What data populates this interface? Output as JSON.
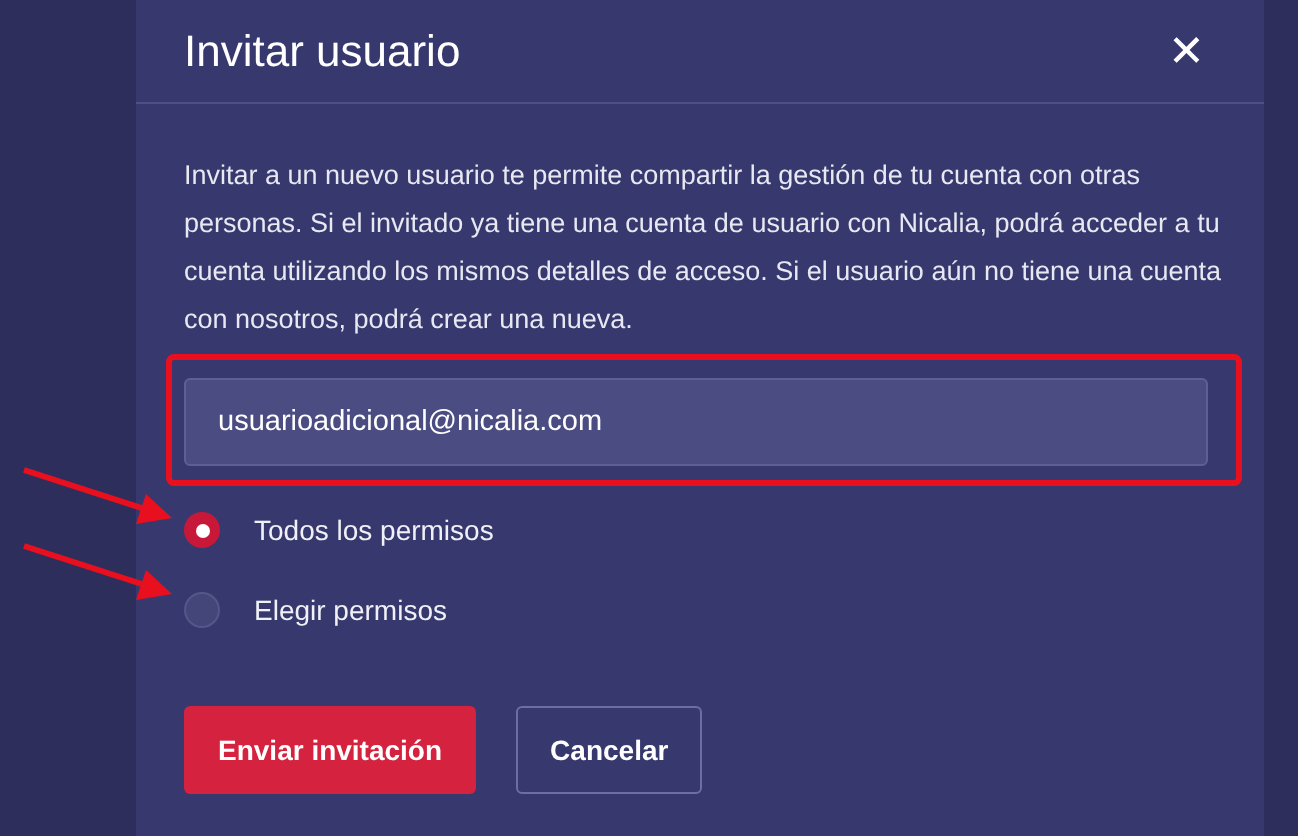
{
  "dialog": {
    "title": "Invitar usuario",
    "close": "✕",
    "description": "Invitar a un nuevo usuario te permite compartir la gestión de tu cuenta con otras personas. Si el invitado ya tiene una cuenta de usuario con Nicalia, podrá acceder a tu cuenta utilizando los mismos detalles de acceso. Si el usuario aún no tiene una cuenta con nosotros, podrá crear una nueva.",
    "email": {
      "value": "usuarioadicional@nicalia.com"
    },
    "permissions": [
      {
        "label": "Todos los permisos",
        "selected": true
      },
      {
        "label": "Elegir permisos",
        "selected": false
      }
    ],
    "buttons": [
      {
        "label": "Enviar invitación",
        "kind": "primary"
      },
      {
        "label": "Cancelar",
        "kind": "secondary"
      }
    ]
  }
}
